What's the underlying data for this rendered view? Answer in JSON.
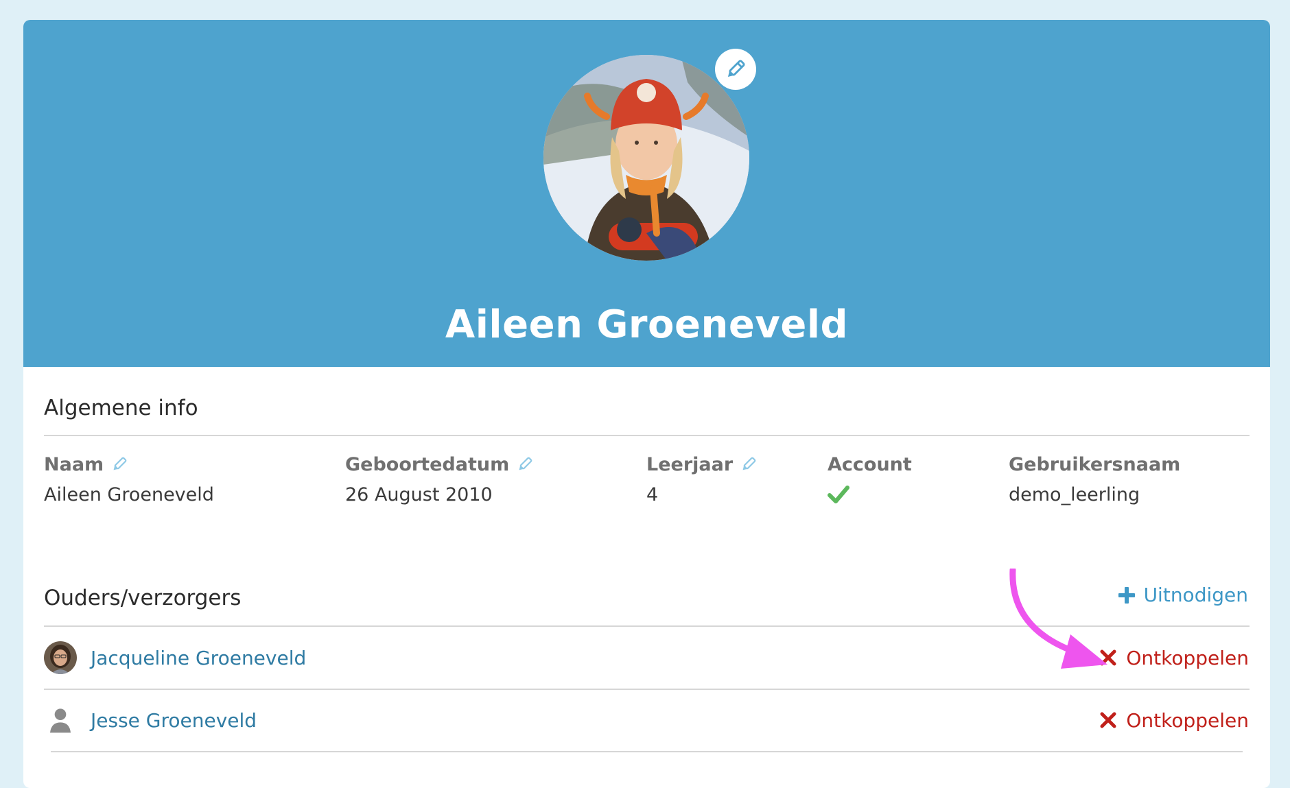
{
  "profile": {
    "name": "Aileen Groeneveld",
    "avatar_edit_icon": "pencil-icon"
  },
  "general_info": {
    "title": "Algemene info",
    "fields": [
      {
        "label": "Naam",
        "value": "Aileen Groeneveld",
        "editable": true
      },
      {
        "label": "Geboortedatum",
        "value": "26 August 2010",
        "editable": true
      },
      {
        "label": "Leerjaar",
        "value": "4",
        "editable": true
      },
      {
        "label": "Account",
        "value_icon": "checkmark-icon",
        "editable": false
      },
      {
        "label": "Gebruikersnaam",
        "value": "demo_leerling",
        "editable": false
      }
    ]
  },
  "parents": {
    "title": "Ouders/verzorgers",
    "invite_label": "Uitnodigen",
    "items": [
      {
        "name": "Jacqueline Groeneveld",
        "avatar": "photo",
        "action_label": "Ontkoppelen"
      },
      {
        "name": "Jesse Groeneveld",
        "avatar": "person-placeholder-icon",
        "action_label": "Ontkoppelen"
      }
    ]
  },
  "colors": {
    "hero": "#4ea3ce",
    "link": "#2f7ba3",
    "accent": "#3d97c6",
    "danger": "#c0201a",
    "success": "#5cb85c",
    "annotation_arrow": "#ee55ee"
  }
}
